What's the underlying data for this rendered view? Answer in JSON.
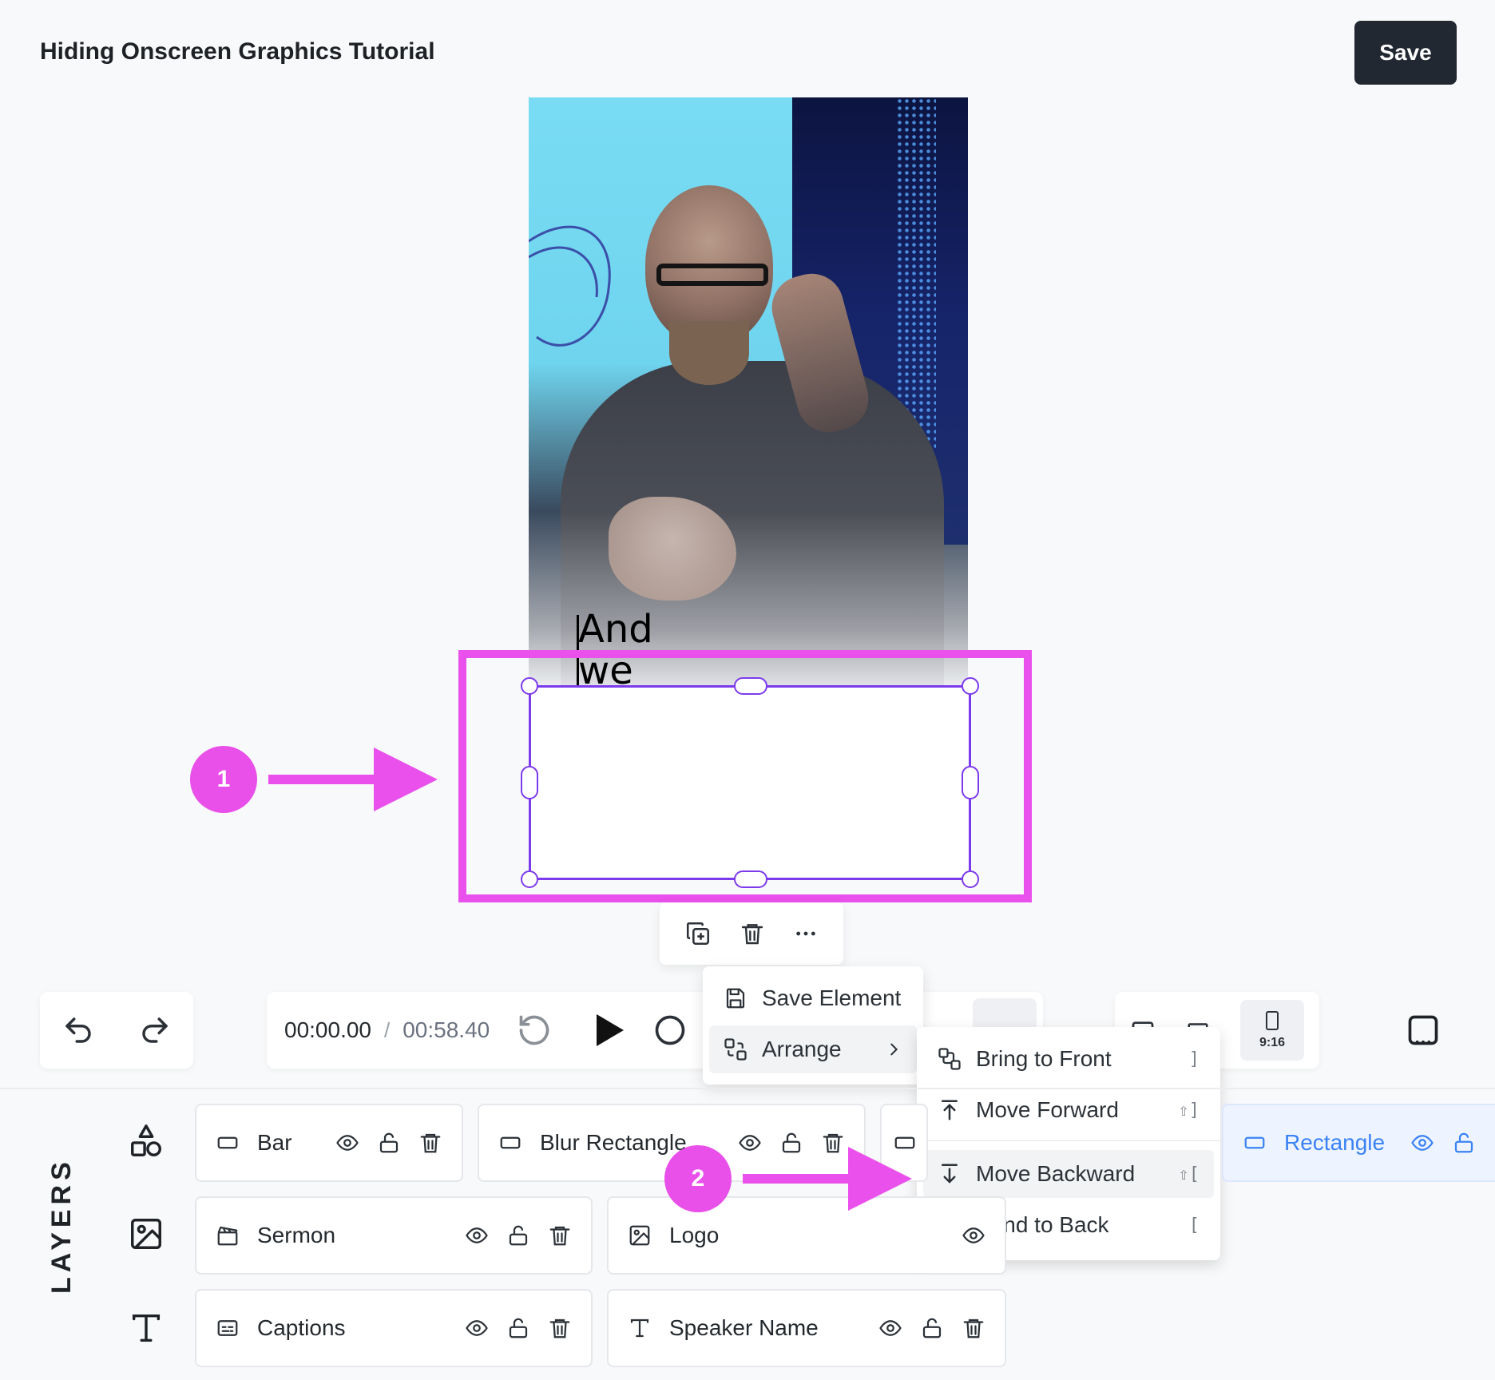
{
  "header": {
    "title": "Hiding Onscreen Graphics Tutorial",
    "save_label": "Save"
  },
  "canvas": {
    "caption_line1": "And",
    "caption_line2": "we"
  },
  "annotations": {
    "badge1": "1",
    "badge2": "2",
    "accent_color": "#ea50ec"
  },
  "element_toolbar": {
    "icons": [
      "duplicate-icon",
      "trash-icon",
      "more-icon"
    ]
  },
  "context_menu": {
    "save_element": "Save Element",
    "arrange": "Arrange"
  },
  "arrange_menu": {
    "items": [
      {
        "label": "Bring to Front",
        "shortcut": "]"
      },
      {
        "label": "Move Forward",
        "shortcut": "⇧]"
      },
      {
        "label": "Move Backward",
        "shortcut": "⇧["
      },
      {
        "label": "Send to Back",
        "shortcut": "["
      }
    ]
  },
  "transport": {
    "current_time": "00:00.00",
    "separator": "/",
    "total_time": "00:58.40"
  },
  "aspect": {
    "selected_label": "9:16"
  },
  "layers": {
    "title": "LAYERS",
    "row1": [
      {
        "name": "Bar",
        "icon": "rectangle-icon"
      },
      {
        "name": "Blur Rectangle",
        "icon": "rectangle-icon"
      },
      {
        "name": "Rectangle",
        "icon": "rectangle-icon",
        "selected": true
      }
    ],
    "row2": [
      {
        "name": "Sermon",
        "icon": "clapperboard-icon"
      },
      {
        "name": "Logo",
        "icon": "image-icon"
      }
    ],
    "row3": [
      {
        "name": "Captions",
        "icon": "captions-icon"
      },
      {
        "name": "Speaker Name",
        "icon": "text-icon"
      }
    ]
  },
  "colors": {
    "selection": "#7c3aed",
    "selected_layer_text": "#3b82f6",
    "save_button": "#212831"
  }
}
